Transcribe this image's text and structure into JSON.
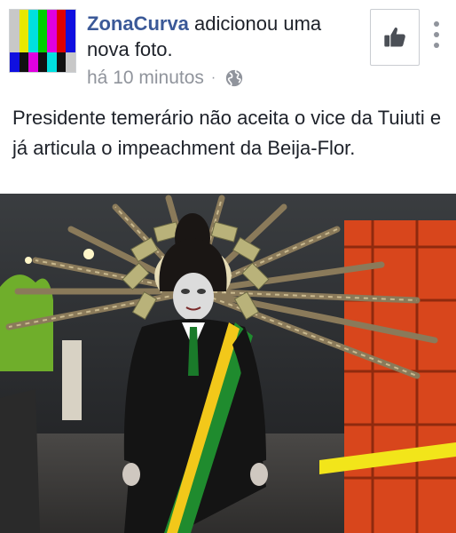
{
  "post": {
    "author": "ZonaCurva",
    "action_text": " adicionou uma nova foto.",
    "timestamp": "há 10 minutos",
    "separator": "·",
    "privacy_icon": "globe-icon",
    "caption": "Presidente temerário não aceita o vice da Tuiuti e já articula o impeachment da Beija-Flor.",
    "like_icon": "thumbs-up-icon",
    "more_icon": "more-vertical-icon",
    "avatar": {
      "bar_colors": [
        "#c8c8c8",
        "#e8e800",
        "#00e0e0",
        "#00d000",
        "#e000e0",
        "#e00000",
        "#1010e0"
      ],
      "bottom_colors": [
        "#1010e0",
        "#111111",
        "#e000e0",
        "#111111",
        "#00e0e0",
        "#111111",
        "#c8c8c8"
      ]
    }
  }
}
